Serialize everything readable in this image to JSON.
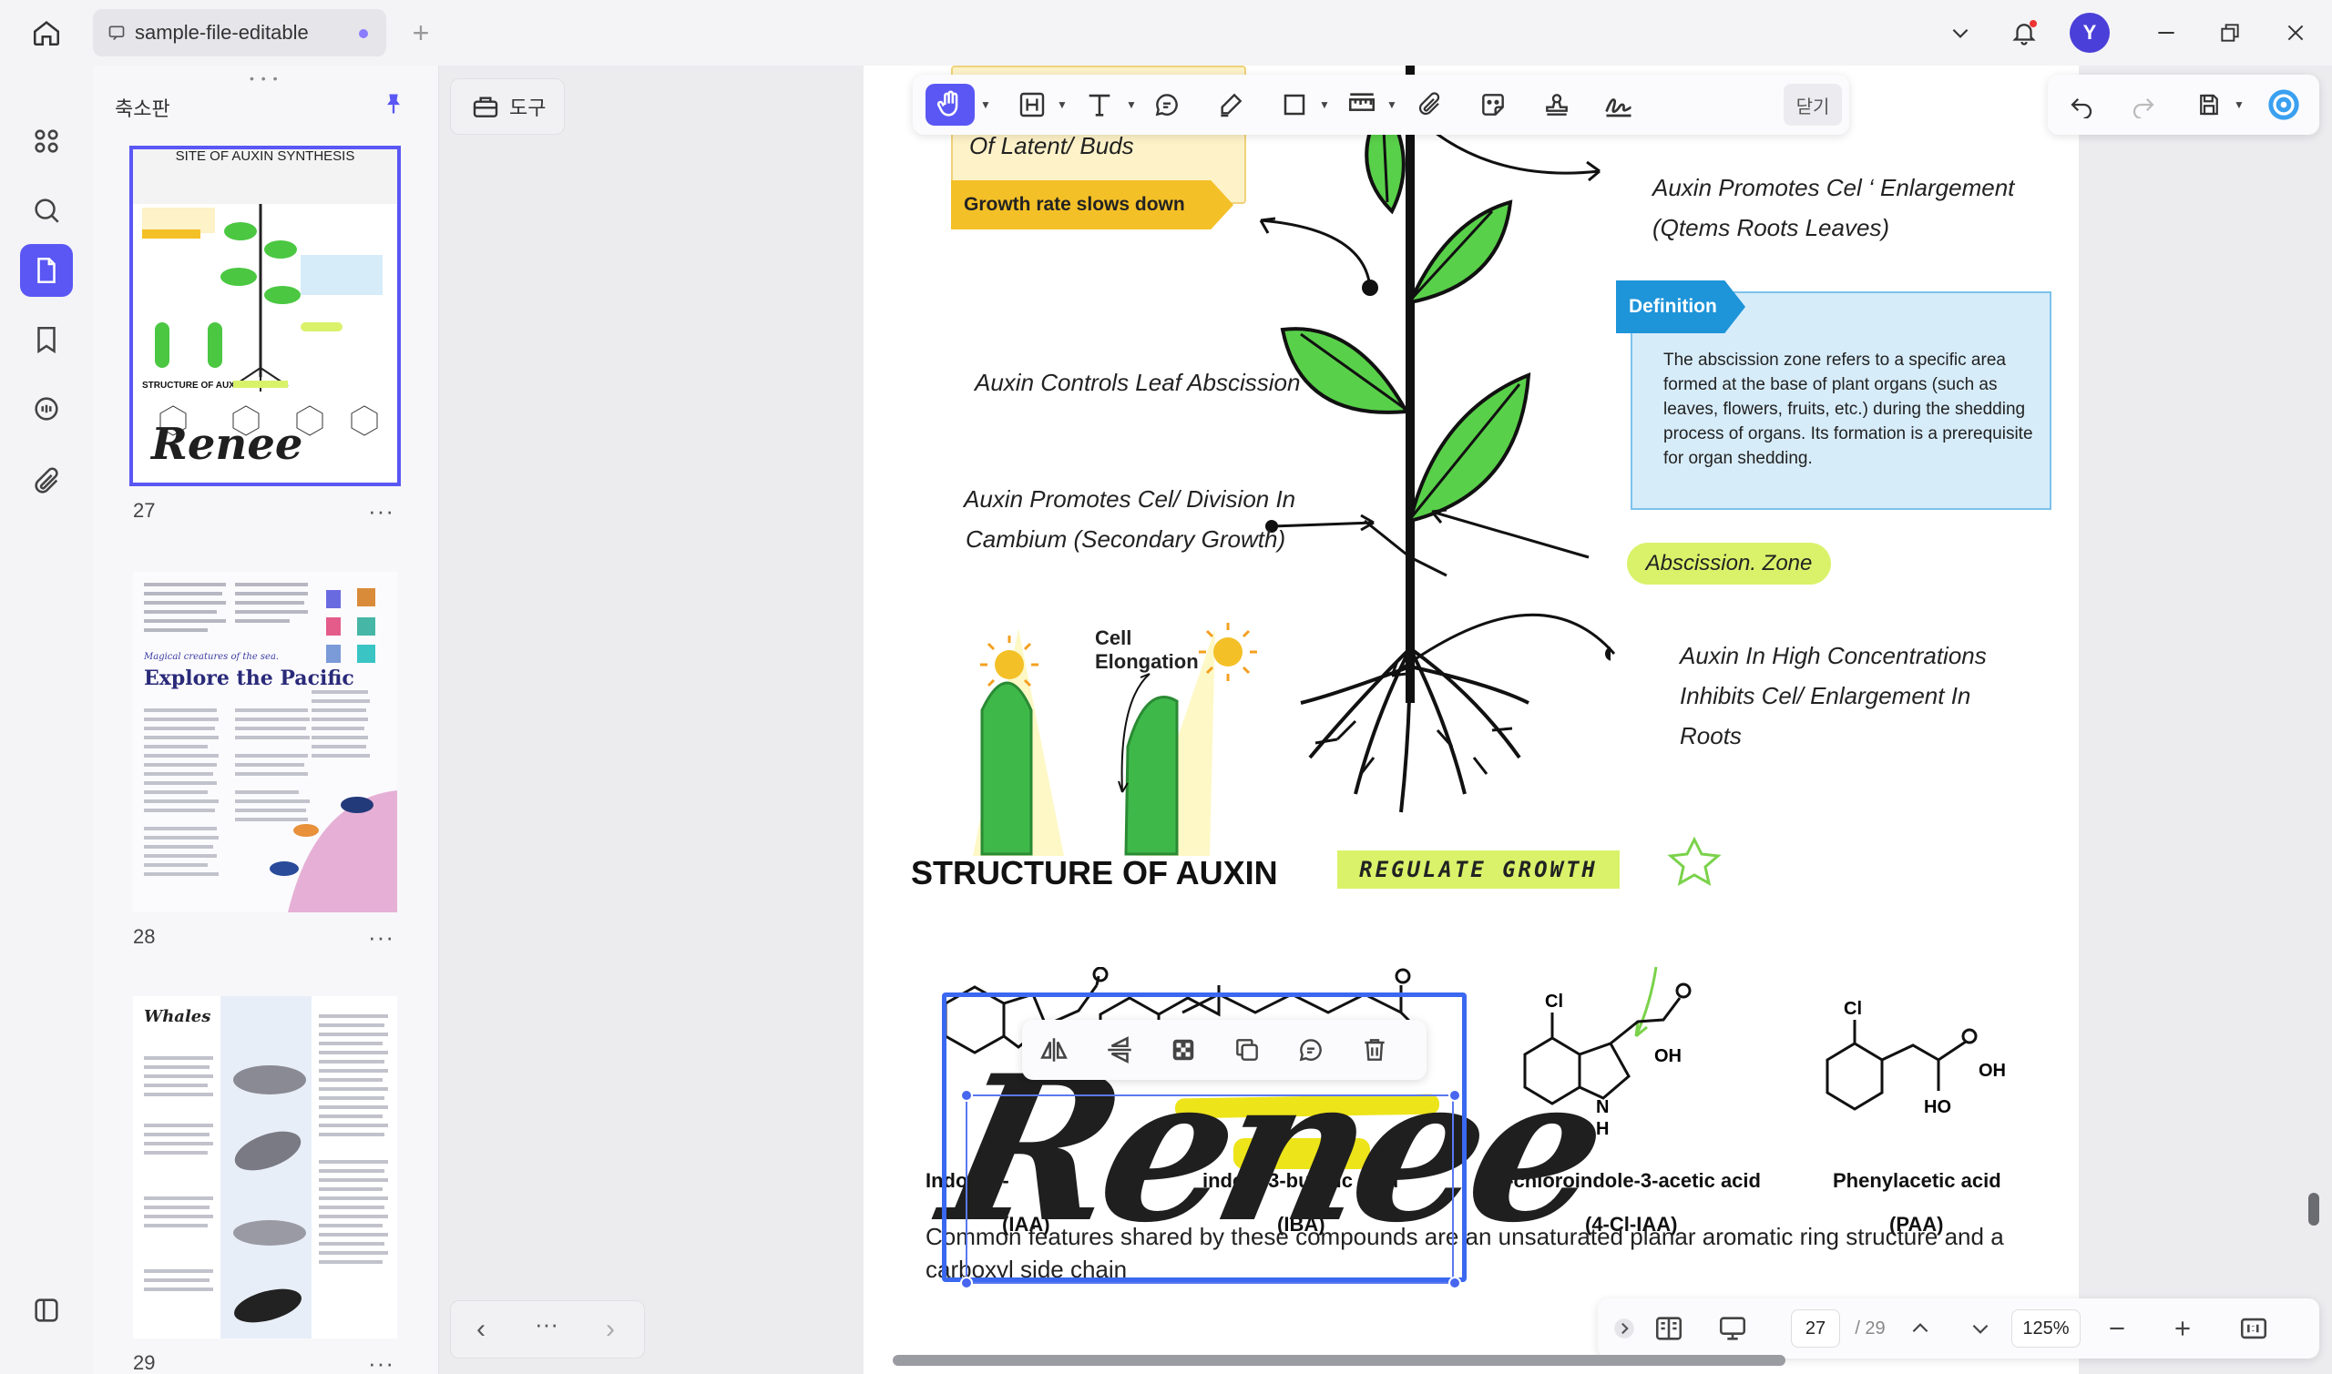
{
  "titlebar": {
    "tab_title": "sample-file-editable",
    "avatar_initial": "Y"
  },
  "thumbnail_panel": {
    "title": "축소판",
    "pages": [
      {
        "number": "27",
        "selected": true,
        "top_title": "SITE OF AUXIN SYNTHESIS",
        "structure_label": "STRUCTURE OF AUXIN",
        "stamp": "Renee"
      },
      {
        "number": "28",
        "selected": false,
        "heading_small": "Magical creatures of the sea.",
        "heading": "Explore the Pacific"
      },
      {
        "number": "29",
        "selected": false,
        "heading": "Whales"
      }
    ],
    "more_label": "···"
  },
  "tools_button": {
    "label": "도구"
  },
  "main_toolbar": {
    "close_label": "닫기",
    "tools": [
      "hand-icon",
      "heading-icon",
      "text-icon",
      "comment-icon",
      "highlighter-icon",
      "rectangle-icon",
      "measure-icon",
      "attach-icon",
      "sticker-icon",
      "stamp-icon",
      "signature-icon"
    ]
  },
  "status_bar": {
    "current_page": "27",
    "total_pages": "/ 29",
    "zoom": "125%"
  },
  "page": {
    "top_text": "Of Latent/ Buds",
    "growth_tag": "Growth rate slows down",
    "cel_enlargement_1": "Auxin Promotes Cel ‘ Enlargement",
    "cel_enlargement_2": "(Qtems Roots Leaves)",
    "definition_tag": "Definition",
    "definition_text": "The abscission zone refers to a specific area formed at the base of plant organs (such as leaves, flowers, fruits, etc.) during the shedding process of organs. Its formation is a prerequisite for organ shedding.",
    "leaf_abscission": "Auxin Controls Leaf Abscission",
    "division_1": "Auxin Promotes Cel/ Division In",
    "division_2": "Cambium (Secondary Growth)",
    "abscission_zone": "Abscission. Zone",
    "cell_elongation_1": "Cell",
    "cell_elongation_2": "Elongation",
    "high_conc_1": "Auxin In High Concentrations",
    "high_conc_2": "Inhibits Cel/ Enlargement In",
    "high_conc_3": "Roots",
    "structure_title": "STRUCTURE OF AUXIN",
    "regulate_growth": "REGULATE GROWTH",
    "chem_iaa_1": "Indole-3-",
    "chem_iaa_2": "(IAA)",
    "chem_iba_1": "indole-3-butyric acid",
    "chem_iba_2": "(IBA)",
    "chem_4cl_1": "4-chloroindole-3-acetic acid",
    "chem_4cl_2": "(4-Cl-IAA)",
    "chem_paa_1": "Phenylacetic acid",
    "chem_paa_2": "(PAA)",
    "oh": "OH",
    "cl": "Cl",
    "ho": "HO",
    "n": "N",
    "h": "H",
    "bottom_text": "Common features shared by these compounds are an unsaturated planar aromatic ring structure and a carboxyl side chain",
    "stamp_text": "Renee"
  }
}
